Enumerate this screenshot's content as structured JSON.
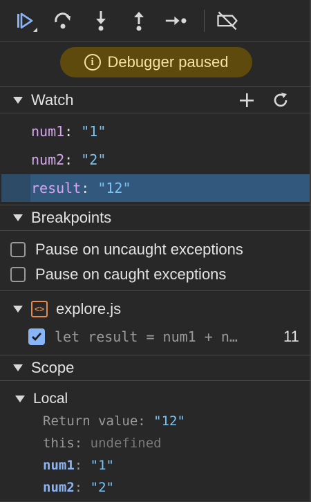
{
  "toolbar": {
    "buttons": [
      {
        "name": "resume-button",
        "icon": "resume-icon"
      },
      {
        "name": "step-over-button",
        "icon": "step-over-icon"
      },
      {
        "name": "step-into-button",
        "icon": "step-into-icon"
      },
      {
        "name": "step-out-button",
        "icon": "step-out-icon"
      },
      {
        "name": "step-button",
        "icon": "step-icon"
      },
      {
        "name": "deactivate-breakpoints-button",
        "icon": "deactivate-breakpoints-icon"
      }
    ],
    "accent": "#8ab4f8"
  },
  "banner": {
    "text": "Debugger paused",
    "icon": "info-icon",
    "bg": "#5e4a0c",
    "fg": "#f5e2a0"
  },
  "watch": {
    "title": "Watch",
    "add_icon": "plus-icon",
    "refresh_icon": "refresh-icon",
    "items": [
      {
        "key": "num1",
        "sep": ": ",
        "value": "\"1\""
      },
      {
        "key": "num2",
        "sep": ": ",
        "value": "\"2\""
      },
      {
        "key": "result",
        "sep": ": ",
        "value": "\"12\""
      }
    ]
  },
  "breakpoints": {
    "title": "Breakpoints",
    "options": [
      {
        "label": "Pause on uncaught exceptions",
        "checked": false
      },
      {
        "label": "Pause on caught exceptions",
        "checked": false
      }
    ],
    "file": {
      "name": "explore.js",
      "icon": "code-file-icon",
      "entry": {
        "code": "let result = num1 + n…",
        "line": "11",
        "checked": true
      }
    }
  },
  "scope": {
    "title": "Scope",
    "local": {
      "title": "Local",
      "items": [
        {
          "key": "Return value",
          "sep": ": ",
          "value": "\"12\""
        },
        {
          "key": "this",
          "sep": ": ",
          "value": "undefined"
        },
        {
          "key": "num1",
          "sep": ": ",
          "value": "\"1\""
        },
        {
          "key": "num2",
          "sep": ": ",
          "value": "\"2\""
        }
      ]
    }
  }
}
